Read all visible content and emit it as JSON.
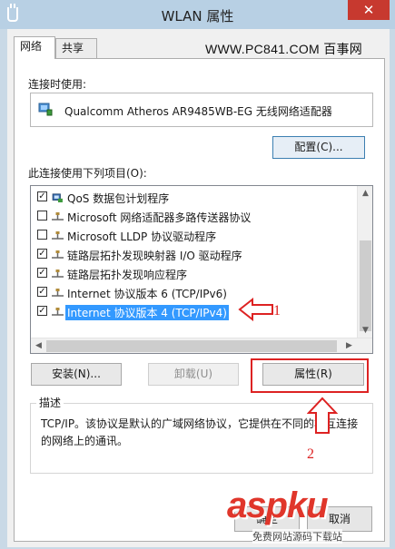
{
  "window": {
    "title": "WLAN 属性",
    "close_glyph": "✕"
  },
  "tabs": [
    {
      "label": "网络"
    },
    {
      "label": "共享"
    }
  ],
  "site_text": "WWW.PC841.COM 百事网",
  "connect_using_label": "连接时使用:",
  "adapter_name": "Qualcomm Atheros AR9485WB-EG 无线网络适配器",
  "configure_button": "配置(C)...",
  "items_label": "此连接使用下列项目(O):",
  "items": [
    {
      "checked": true,
      "label": "QoS 数据包计划程序",
      "icon": "qos-icon"
    },
    {
      "checked": false,
      "label": "Microsoft 网络适配器多路传送器协议",
      "icon": "protocol-icon"
    },
    {
      "checked": false,
      "label": "Microsoft LLDP 协议驱动程序",
      "icon": "protocol-icon"
    },
    {
      "checked": true,
      "label": "链路层拓扑发现映射器 I/O 驱动程序",
      "icon": "protocol-icon"
    },
    {
      "checked": true,
      "label": "链路层拓扑发现响应程序",
      "icon": "protocol-icon"
    },
    {
      "checked": true,
      "label": "Internet 协议版本 6 (TCP/IPv6)",
      "icon": "protocol-icon"
    },
    {
      "checked": true,
      "label": "Internet 协议版本 4 (TCP/IPv4)",
      "icon": "protocol-icon",
      "selected": true
    }
  ],
  "buttons": {
    "install": "安装(N)...",
    "uninstall": "卸载(U)",
    "properties": "属性(R)"
  },
  "description": {
    "title": "描述",
    "text": "TCP/IP。该协议是默认的广域网络协议，它提供在不同的相互连接的网络上的通讯。"
  },
  "annotations": {
    "num1": "1",
    "num2": "2",
    "color": "#dd2222"
  },
  "bottom_buttons": {
    "ok": "确定",
    "cancel": "取消"
  },
  "watermark": {
    "text": "aspku",
    "sub": "免费网站源码下载站"
  }
}
